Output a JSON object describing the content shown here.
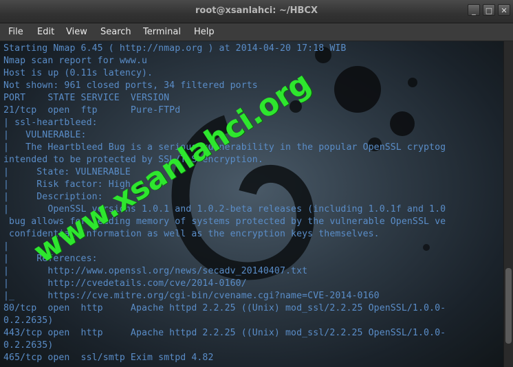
{
  "window": {
    "title": "root@xsanlahci: ~/HBCX",
    "buttons": [
      "_",
      "□",
      "✕"
    ]
  },
  "menubar": {
    "items": [
      "File",
      "Edit",
      "View",
      "Search",
      "Terminal",
      "Help"
    ]
  },
  "terminal": {
    "lines": [
      "Starting Nmap 6.45 ( http://nmap.org ) at 2014-04-20 17:18 WIB",
      "Nmap scan report for www.u",
      "Host is up (0.11s latency).",
      "Not shown: 961 closed ports, 34 filtered ports",
      "PORT    STATE SERVICE  VERSION",
      "21/tcp  open  ftp      Pure-FTPd",
      "| ssl-heartbleed:",
      "|   VULNERABLE:",
      "|   The Heartbleed Bug is a serious vulnerability in the popular OpenSSL cryptog",
      "intended to be protected by SSL/TLS encryption.",
      "|     State: VULNERABLE",
      "|     Risk factor: High",
      "|     Description:",
      "|       OpenSSL versions 1.0.1 and 1.0.2-beta releases (including 1.0.1f and 1.0",
      " bug allows for reading memory of systems protected by the vulnerable OpenSSL ve",
      " confidential information as well as the encryption keys themselves.",
      "|",
      "|     References:",
      "|       http://www.openssl.org/news/secadv_20140407.txt",
      "|       http://cvedetails.com/cve/2014-0160/",
      "|_      https://cve.mitre.org/cgi-bin/cvename.cgi?name=CVE-2014-0160",
      "80/tcp  open  http     Apache httpd 2.2.25 ((Unix) mod_ssl/2.2.25 OpenSSL/1.0.0-",
      "0.2.2635)",
      "443/tcp open  http     Apache httpd 2.2.25 ((Unix) mod_ssl/2.2.25 OpenSSL/1.0.0-",
      "0.2.2635)",
      "465/tcp open  ssl/smtp Exim smtpd 4.82"
    ]
  },
  "watermark": "www.xsanlahci.org",
  "colors": {
    "terminal_text": "#5a8dc8",
    "watermark": "#2ee62e",
    "menubar_bg": "#3c3c3c"
  }
}
